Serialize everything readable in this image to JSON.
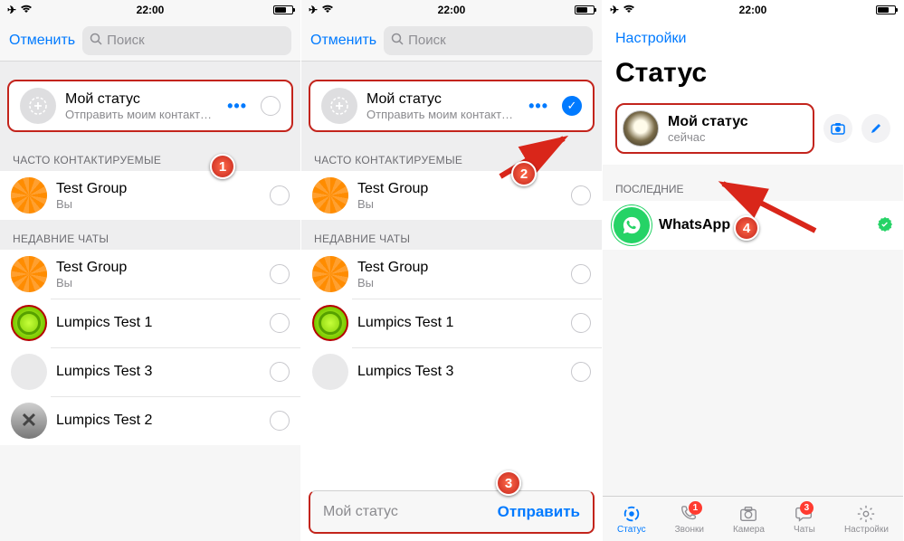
{
  "status_bar": {
    "time": "22:00"
  },
  "header": {
    "cancel_label": "Отменить",
    "search_placeholder": "Поиск"
  },
  "my_status": {
    "title": "Мой статус",
    "subtitle": "Отправить моим контактам, кр...",
    "dots": "•••"
  },
  "sections": {
    "frequent": "ЧАСТО КОНТАКТИРУЕМЫЕ",
    "recent": "НЕДАВНИЕ ЧАТЫ",
    "latest": "ПОСЛЕДНИЕ"
  },
  "contacts": {
    "test_group": {
      "name": "Test Group",
      "sub": "Вы"
    },
    "lumpics1": {
      "name": "Lumpics Test 1",
      "sub": ""
    },
    "lumpics3": {
      "name": "Lumpics Test 3",
      "sub": ""
    },
    "lumpics2": {
      "name": "Lumpics Test 2",
      "sub": ""
    },
    "whatsapp": {
      "name": "WhatsApp"
    }
  },
  "footer": {
    "label": "Мой статус",
    "send": "Отправить"
  },
  "panel3": {
    "back": "Настройки",
    "title": "Статус",
    "my_status_title": "Мой статус",
    "my_status_sub": "сейчас"
  },
  "tabs": {
    "status": "Статус",
    "calls": "Звонки",
    "camera": "Камера",
    "chats": "Чаты",
    "settings": "Настройки",
    "calls_badge": "1",
    "chats_badge": "3"
  },
  "annotations": {
    "n1": "1",
    "n2": "2",
    "n3": "3",
    "n4": "4"
  }
}
